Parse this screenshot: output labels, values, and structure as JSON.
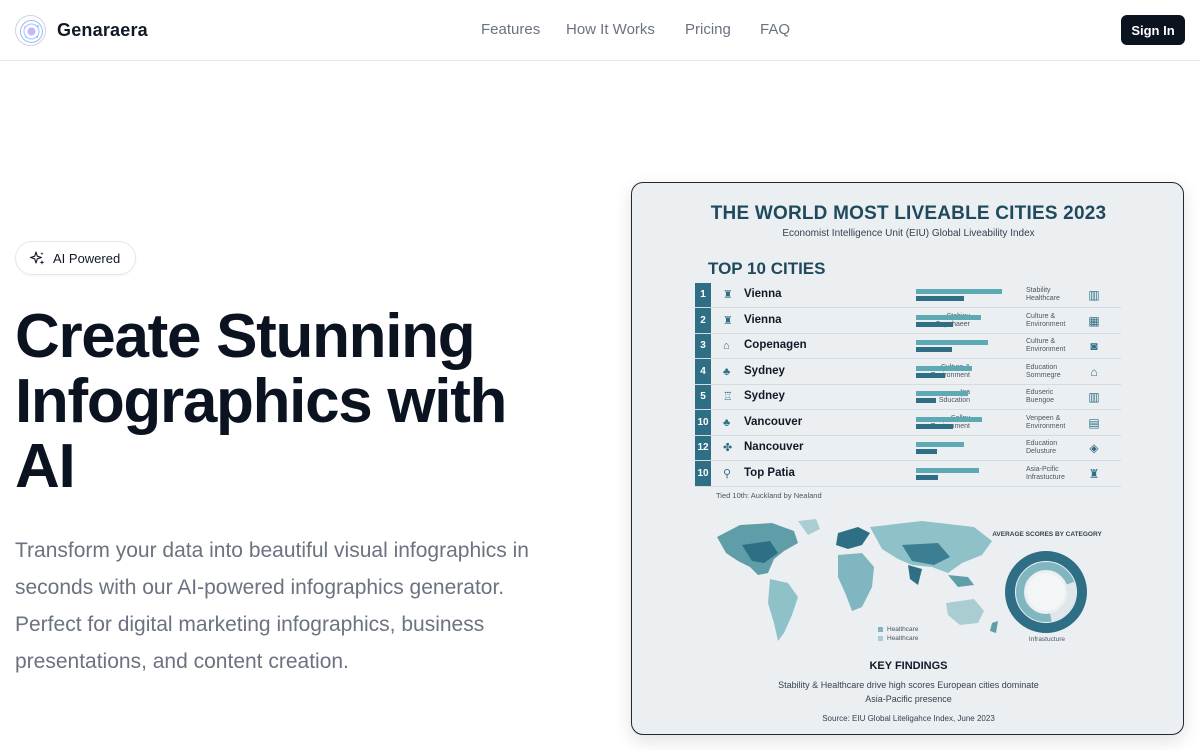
{
  "header": {
    "brand": "Genaraera",
    "nav": [
      "Features",
      "How It Works",
      "Pricing",
      "FAQ"
    ],
    "signin_label": "Sign In"
  },
  "hero": {
    "badge": "AI Powered",
    "title_lines": [
      "Create Stunning",
      "Infographics with",
      "AI"
    ],
    "subtitle_lines": [
      "Transform your data into beautiful visual infographics in",
      "seconds with our AI-powered infographics generator.",
      "Perfect for digital marketing infographics, business",
      "presentations, and content creation."
    ]
  },
  "infographic": {
    "title": "THE WORLD MOST LIVEABLE CITIES 2023",
    "subtitle": "Economist Intelligence Unit (EIU) Global Liveability Index",
    "section_title": "TOP 10 CITIES",
    "rows": [
      {
        "rank": "1",
        "city": "Vienna",
        "mid": [
          "",
          ""
        ],
        "right": [
          "Stability",
          "Healthcare"
        ],
        "bars": [
          0.95,
          0.53
        ]
      },
      {
        "rank": "2",
        "city": "Vienna",
        "mid": [
          "Stabiny",
          "Copehaeer"
        ],
        "right": [
          "Culture &",
          "Environment"
        ],
        "bars": [
          0.72,
          0.41
        ]
      },
      {
        "rank": "3",
        "city": "Copenagen",
        "mid": [
          "",
          ""
        ],
        "right": [
          "Culture &",
          "Environment"
        ],
        "bars": [
          0.8,
          0.4
        ]
      },
      {
        "rank": "4",
        "city": "Sydney",
        "mid": [
          "Culture &",
          "Environment"
        ],
        "right": [
          "Education",
          "Sornmegre"
        ],
        "bars": [
          0.62,
          0.32
        ]
      },
      {
        "rank": "5",
        "city": "Sydney",
        "mid": [
          "Ina",
          "Sducation"
        ],
        "right": [
          "Eduseric",
          "Buengoe"
        ],
        "bars": [
          0.58,
          0.22
        ]
      },
      {
        "rank": "10",
        "city": "Vancouver",
        "mid": [
          "Sollny",
          "Environment"
        ],
        "right": [
          "Venpeen &",
          "Environment"
        ],
        "bars": [
          0.73,
          0.41
        ]
      },
      {
        "rank": "12",
        "city": "Nancouver",
        "mid": [
          "",
          ""
        ],
        "right": [
          "Education",
          "Delusture"
        ],
        "bars": [
          0.53,
          0.23
        ]
      },
      {
        "rank": "10",
        "city": "Top Patia",
        "mid": [
          "",
          ""
        ],
        "right": [
          "Asia-Pcific",
          "Infrastucture"
        ],
        "bars": [
          0.7,
          0.24
        ]
      }
    ],
    "tied_note": "Tied 10th: Auckland by Nealand",
    "average_title": "AVERAGE SCORES BY CATEGORY",
    "donut_label": "Infrastucture",
    "legend": [
      "Healthcare",
      "Healthcare"
    ],
    "key_findings_title": "KEY FINDINGS",
    "key_findings": [
      "Stability & Healthcare drive high scores  European cities dominate",
      "Asia-Pacific presence"
    ],
    "source": "Source: EIU Global Liteligahce Index, June 2023"
  },
  "colors": {
    "dark_teal": "#2f6f86",
    "light_teal": "#5da9b4",
    "signin_bg": "#0b1220"
  }
}
